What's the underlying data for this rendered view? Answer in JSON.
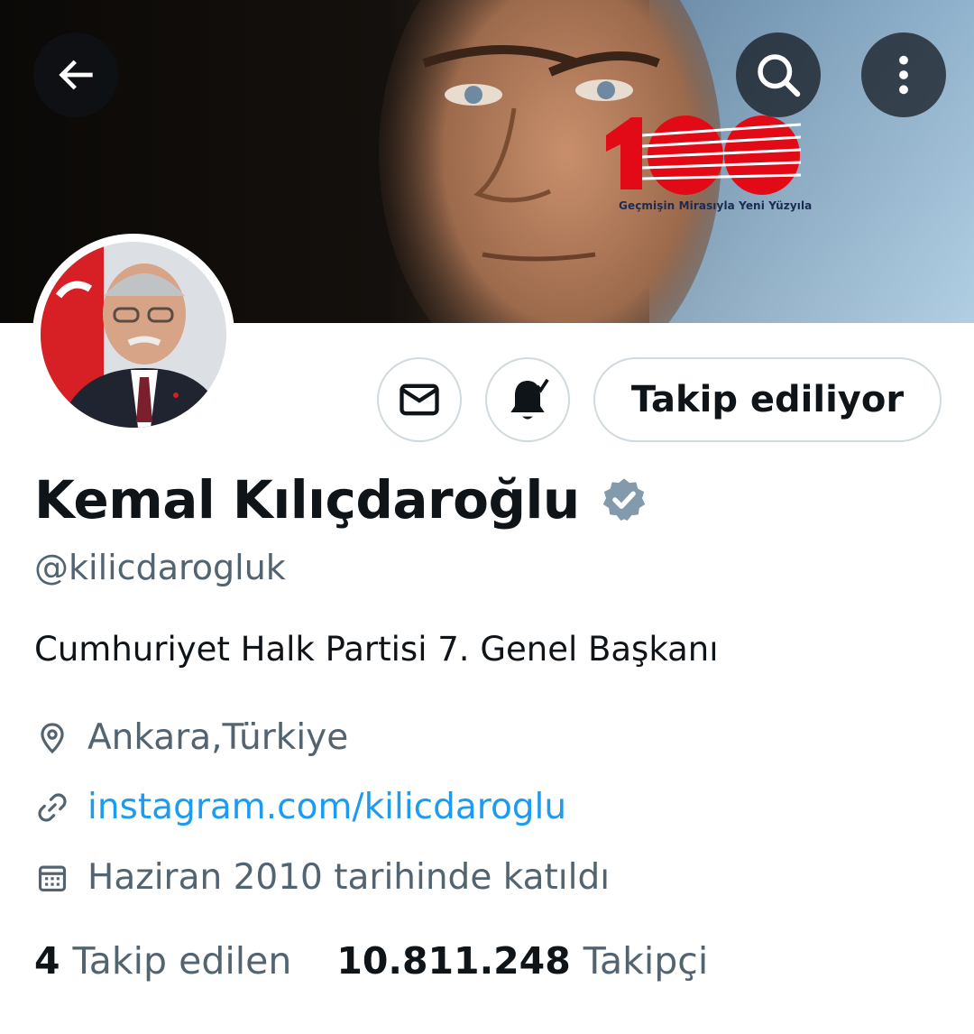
{
  "header": {
    "back_icon": "arrow-left-icon",
    "search_icon": "search-icon",
    "more_icon": "more-vertical-icon",
    "banner": {
      "badge_text": "100",
      "badge_subtitle": "Geçmişin Mirasıyla Yeni Yüzyıla",
      "badge_color": "#e30a17"
    }
  },
  "actions": {
    "message_icon": "envelope-icon",
    "notify_icon": "bell-check-icon",
    "follow_label": "Takip ediliyor"
  },
  "profile": {
    "name": "Kemal Kılıçdaroğlu",
    "verified_icon": "verified-badge-icon",
    "verified_color": "#829aab",
    "handle": "@kilicdarogluk",
    "bio": "Cumhuriyet Halk Partisi 7. Genel Başkanı",
    "location": "Ankara,Türkiye",
    "website": "instagram.com/kilicdaroglu",
    "joined": "Haziran 2010 tarihinde katıldı"
  },
  "stats": {
    "following_count": "4",
    "following_label": "Takip edilen",
    "followers_count": "10.811.248",
    "followers_label": "Takipçi"
  },
  "colors": {
    "link": "#1d9bf0",
    "secondary_text": "#536471",
    "primary_text": "#0f1419"
  }
}
